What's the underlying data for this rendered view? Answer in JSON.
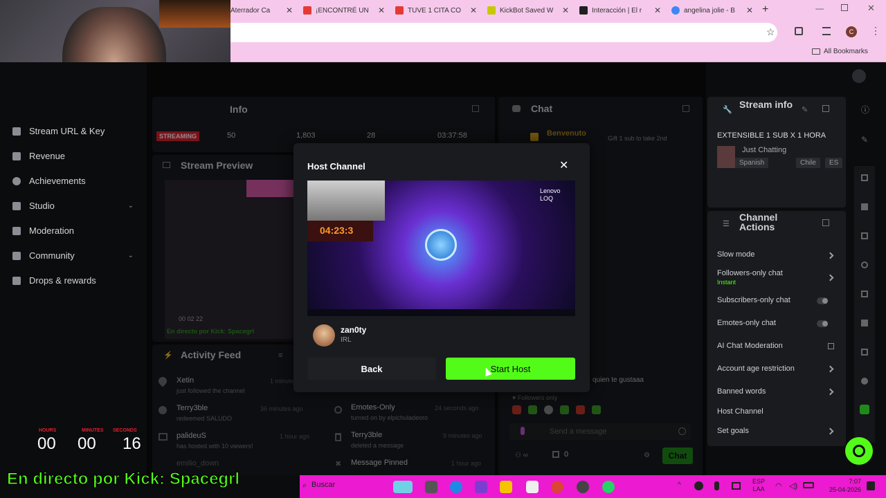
{
  "browser": {
    "tabs": [
      {
        "label": "Aterrador Ca",
        "color": "#e53935"
      },
      {
        "label": "¡ENCONTRÉ UN",
        "color": "#e53935"
      },
      {
        "label": "TUVE 1 CITA CO",
        "color": "#e53935"
      },
      {
        "label": "KickBot Saved W",
        "color": "#c8c800"
      },
      {
        "label": "Interacción | El r",
        "color": "#202020"
      },
      {
        "label": "angelina jolie - B",
        "color": "#4285f4"
      }
    ],
    "new_tab": "+",
    "profile_initial": "C",
    "bookmarks_label": "All Bookmarks"
  },
  "sidebar": {
    "items": [
      {
        "label": "Stream URL & Key"
      },
      {
        "label": "Revenue"
      },
      {
        "label": "Achievements"
      },
      {
        "label": "Studio"
      },
      {
        "label": "Moderation"
      },
      {
        "label": "Community"
      },
      {
        "label": "Drops & rewards"
      }
    ]
  },
  "session": {
    "title": "Info",
    "status": "STREAMING",
    "viewers": "50",
    "followers": "1,803",
    "subs": "28",
    "duration": "03:37:58"
  },
  "preview": {
    "title": "Stream Preview",
    "caption": "En directo por Kick: Spacegrl",
    "timer": "00  02  22"
  },
  "activity": {
    "title": "Activity Feed",
    "items": [
      {
        "name": "Xetin",
        "sub": "just followed the channel",
        "time": "1 minute ago"
      },
      {
        "name": "Terry3ble",
        "sub": "redeemed SALUDO",
        "time": "36 minutes ago"
      },
      {
        "name": "palideuS",
        "sub": "has hosted with 10 viewers!",
        "time": "1 hour ago"
      },
      {
        "name": "emilio_down",
        "sub": "",
        "time": ""
      }
    ],
    "items2": [
      {
        "name": "Emotes-Only",
        "sub": "turned on by elpichuladeoro",
        "time": "24 seconds ago"
      },
      {
        "name": "Terry3ble",
        "sub": "deleted a message",
        "time": "9 minutes ago"
      },
      {
        "name": "Message Pinned",
        "sub": "",
        "time": "1 hour ago"
      }
    ]
  },
  "chat": {
    "title": "Chat",
    "welcome": "Benvenuto",
    "gift_text": "Gift 1 sub to take 2nd",
    "last_line": "quien te gustaaa",
    "followers_only": "Followers only",
    "placeholder": "Send a message",
    "send_label": "Chat",
    "count": "0"
  },
  "stream_info": {
    "title": "Stream info",
    "stream_title": "EXTENSIBLE 1 SUB X 1 HORA",
    "category": "Just Chatting",
    "tags": [
      "Spanish",
      "Chile",
      "ES"
    ]
  },
  "channel_actions": {
    "title": "Channel Actions",
    "items": [
      {
        "label": "Slow mode",
        "kind": "chev"
      },
      {
        "label": "Followers-only chat",
        "sub": "Instant",
        "kind": "chev"
      },
      {
        "label": "Subscribers-only chat",
        "kind": "toggle"
      },
      {
        "label": "Emotes-only chat",
        "kind": "toggle"
      },
      {
        "label": "AI Chat Moderation",
        "kind": "ext"
      },
      {
        "label": "Account age restriction",
        "kind": "chev"
      },
      {
        "label": "Banned words",
        "kind": "chev"
      },
      {
        "label": "Host Channel",
        "kind": "none"
      },
      {
        "label": "Set goals",
        "kind": "chev"
      }
    ]
  },
  "modal": {
    "title": "Host Channel",
    "thumb_timer": "04:23:3",
    "thumb_brand": "Lenovo LOQ",
    "channel_name": "zan0ty",
    "channel_category": "IRL",
    "back_label": "Back",
    "host_label": "Start Host"
  },
  "overlay": {
    "counter_labels": [
      "HOURS",
      "MINUTES",
      "SECONDS"
    ],
    "counter_values": [
      "00",
      "00",
      "16"
    ],
    "banner": "En directo por Kick: Spacegrl"
  },
  "taskbar": {
    "search_placeholder": "Buscar",
    "lang": "ESP",
    "layout": "LAA",
    "time": "7:07",
    "date": "25-04-2026"
  }
}
